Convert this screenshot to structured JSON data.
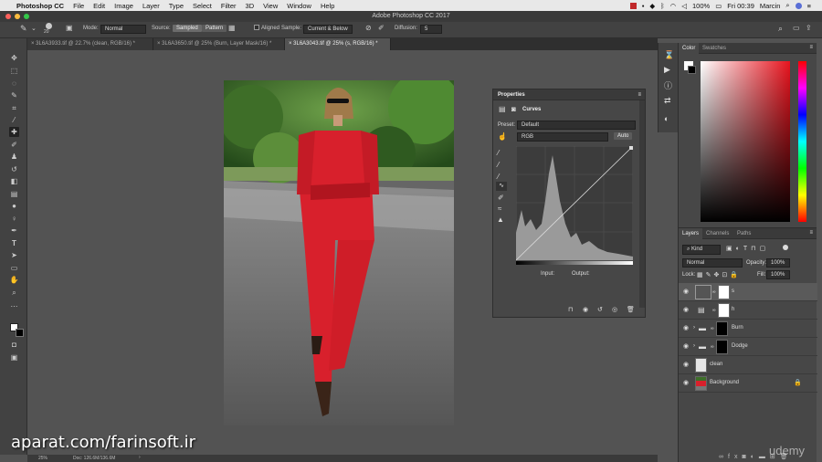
{
  "menubar": {
    "apple": "",
    "app_name": "Photoshop CC",
    "items": [
      "File",
      "Edit",
      "Image",
      "Layer",
      "Type",
      "Select",
      "Filter",
      "3D",
      "View",
      "Window",
      "Help"
    ],
    "battery": "100%",
    "clock": "Fri 00:39",
    "user": "Marcin"
  },
  "window_title": "Adobe Photoshop CC 2017",
  "options": {
    "brush_size": "20",
    "mode_label": "Mode:",
    "mode_value": "Normal",
    "source_label": "Source:",
    "sampled_label": "Sampled",
    "pattern_label": "Pattern",
    "aligned_label": "Aligned",
    "sample_label": "Sample:",
    "sample_value": "Current & Below",
    "diffusion_label": "Diffusion:",
    "diffusion_value": "5"
  },
  "tabs": [
    {
      "label": "3L6A3933.tif @ 22.7% (clean, RGB/16) *"
    },
    {
      "label": "3L6A3650.tif @ 25% (Burn, Layer Mask/16) *"
    },
    {
      "label": "3L6A3043.tif @ 25% (s, RGB/16) *"
    }
  ],
  "properties": {
    "title": "Properties",
    "adjustment": "Curves",
    "preset_label": "Preset:",
    "preset_value": "Default",
    "channel_value": "RGB",
    "auto_label": "Auto",
    "input_label": "Input:",
    "output_label": "Output:"
  },
  "color_panel": {
    "tab_color": "Color",
    "tab_swatches": "Swatches"
  },
  "layers_panel": {
    "tab_layers": "Layers",
    "tab_channels": "Channels",
    "tab_paths": "Paths",
    "filter_value": "Kind",
    "blend_value": "Normal",
    "opacity_label": "Opacity:",
    "opacity_value": "100%",
    "lock_label": "Lock:",
    "fill_label": "Fill:",
    "fill_value": "100%",
    "layers": [
      {
        "name": "s"
      },
      {
        "name": "h"
      },
      {
        "name": "Burn"
      },
      {
        "name": "Dodge"
      },
      {
        "name": "clean"
      },
      {
        "name": "Background"
      }
    ]
  },
  "status": {
    "zoom": "25%",
    "doc_info": "Doc: 126.6M/136.6M"
  },
  "watermark": "aparat.com/farinsoft.ir",
  "udemy": "udemy",
  "colors": {
    "accent_blue": "#3b7ed6",
    "suit_red": "#d8202c"
  }
}
